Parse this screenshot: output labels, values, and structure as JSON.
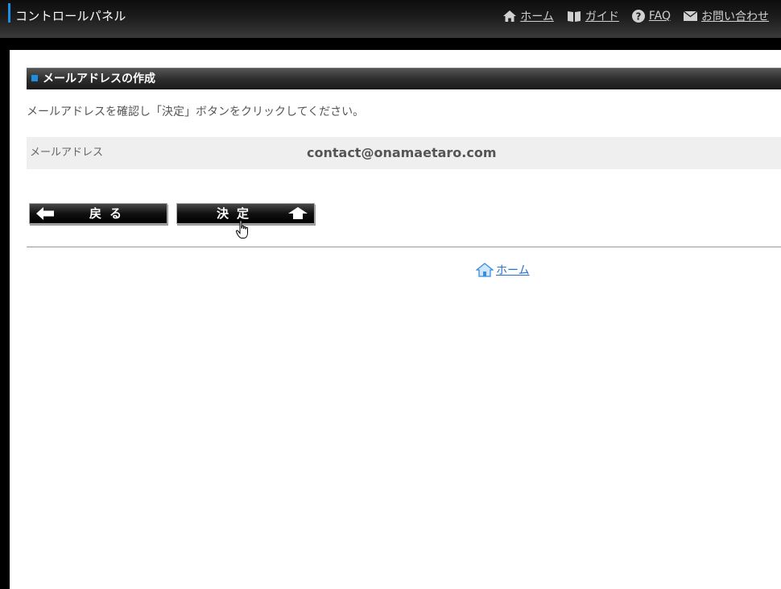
{
  "header": {
    "title": "コントロールパネル",
    "nav": {
      "home": "ホーム",
      "guide": "ガイド",
      "faq": "FAQ",
      "contact": "お問い合わせ"
    }
  },
  "section": {
    "title": "メールアドレスの作成",
    "instruction": "メールアドレスを確認し「決定」ボタンをクリックしてください。",
    "field_label": "メールアドレス",
    "field_value": "contact@onamaetaro.com"
  },
  "buttons": {
    "back": "戻る",
    "confirm": "決定"
  },
  "footer": {
    "home_link": "ホーム"
  },
  "colors": {
    "accent": "#1e8fe0",
    "link": "#2a6fd0"
  }
}
